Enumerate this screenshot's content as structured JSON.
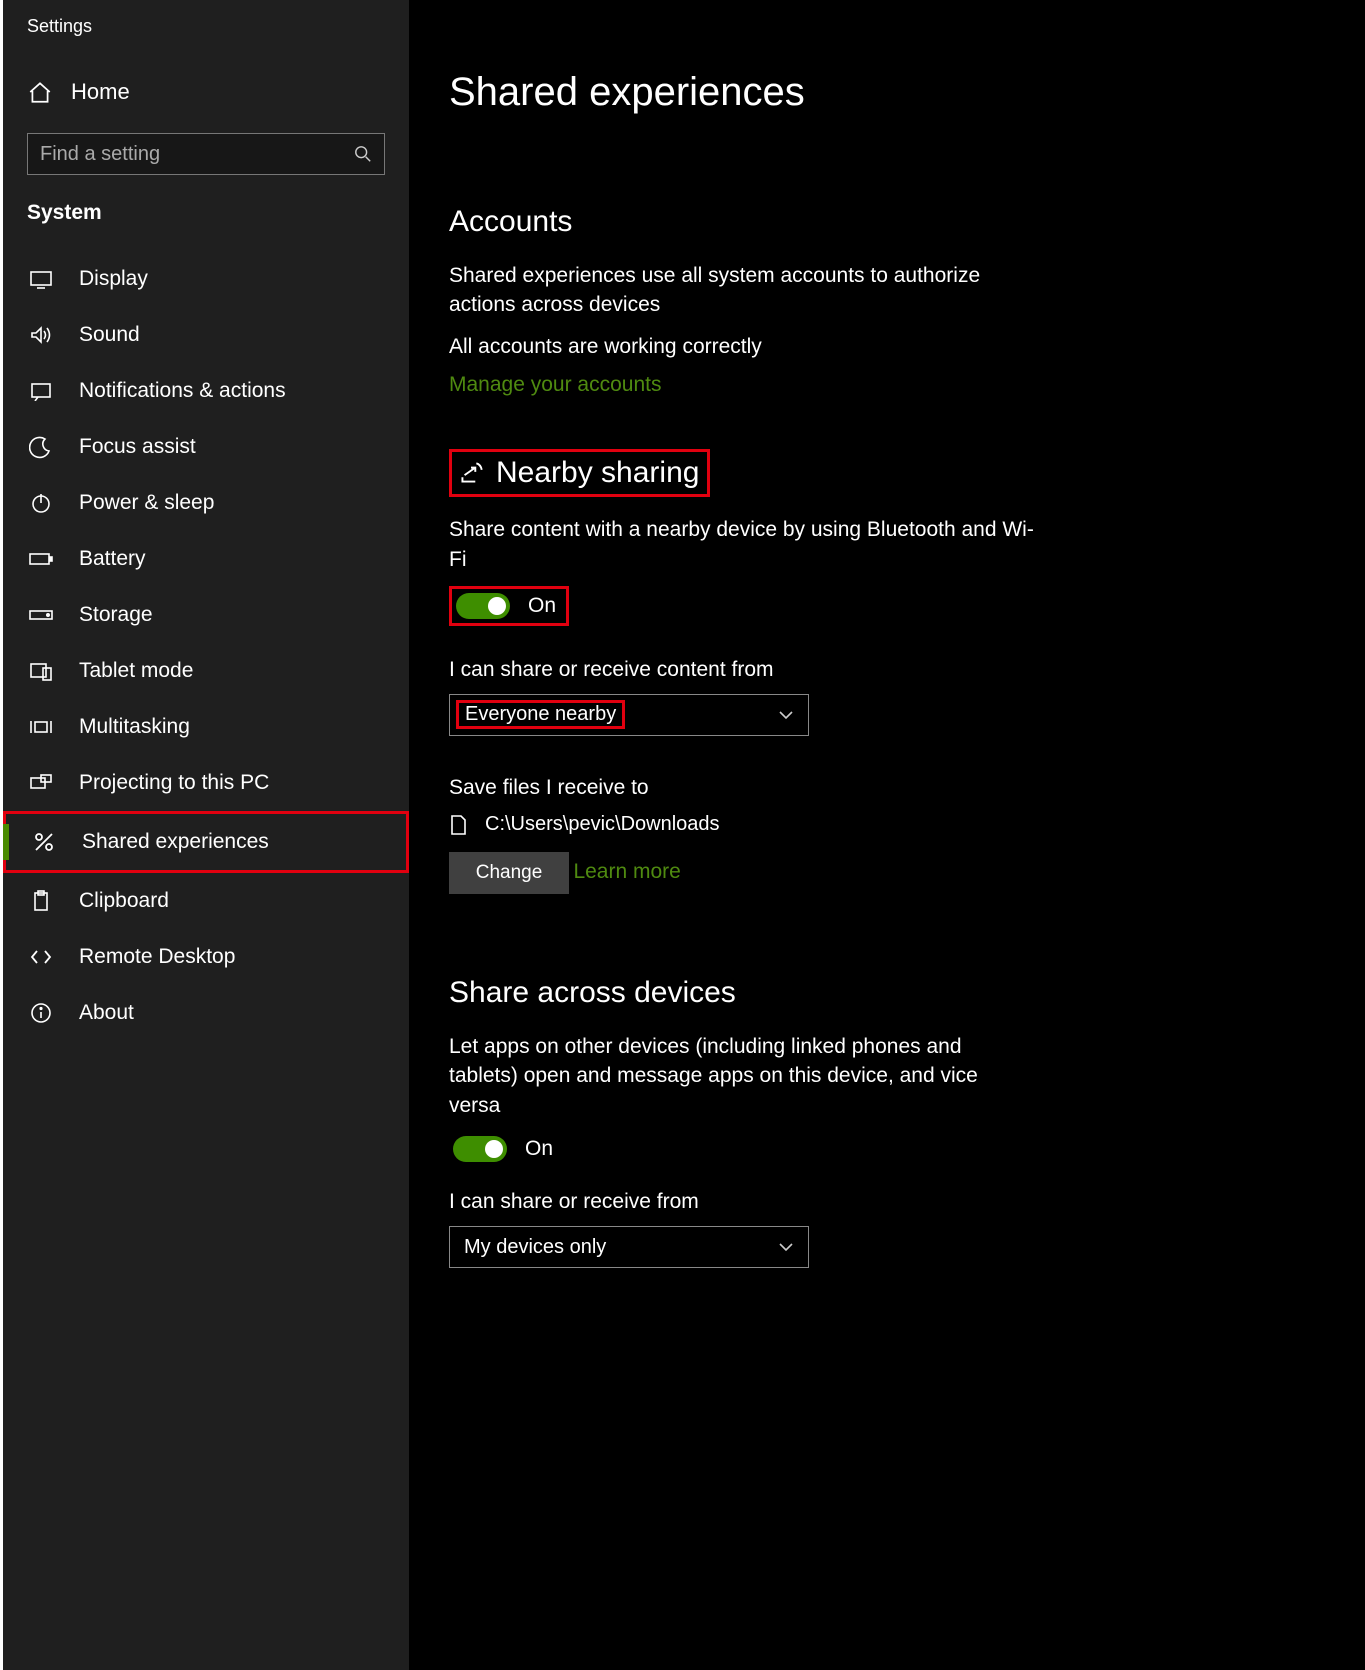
{
  "window_title": "Settings",
  "home_label": "Home",
  "search_placeholder": "Find a setting",
  "category": "System",
  "nav": [
    {
      "label": "Display"
    },
    {
      "label": "Sound"
    },
    {
      "label": "Notifications & actions"
    },
    {
      "label": "Focus assist"
    },
    {
      "label": "Power & sleep"
    },
    {
      "label": "Battery"
    },
    {
      "label": "Storage"
    },
    {
      "label": "Tablet mode"
    },
    {
      "label": "Multitasking"
    },
    {
      "label": "Projecting to this PC"
    },
    {
      "label": "Shared experiences"
    },
    {
      "label": "Clipboard"
    },
    {
      "label": "Remote Desktop"
    },
    {
      "label": "About"
    }
  ],
  "page_title": "Shared experiences",
  "accounts": {
    "heading": "Accounts",
    "desc": "Shared experiences use all system accounts to authorize actions across devices",
    "status": "All accounts are working correctly",
    "manage_link": "Manage your accounts"
  },
  "nearby": {
    "heading": "Nearby sharing",
    "desc": "Share content with a nearby device by using Bluetooth and Wi-Fi",
    "toggle_label": "On",
    "receive_heading": "I can share or receive content from",
    "receive_value": "Everyone nearby",
    "save_heading": "Save files I receive to",
    "path": "C:\\Users\\pevic\\Downloads",
    "change_btn": "Change",
    "learn_more": "Learn more"
  },
  "across": {
    "heading": "Share across devices",
    "desc": "Let apps on other devices (including linked phones and tablets) open and message apps on this device, and vice versa",
    "toggle_label": "On",
    "receive_heading": "I can share or receive from",
    "receive_value": "My devices only"
  }
}
